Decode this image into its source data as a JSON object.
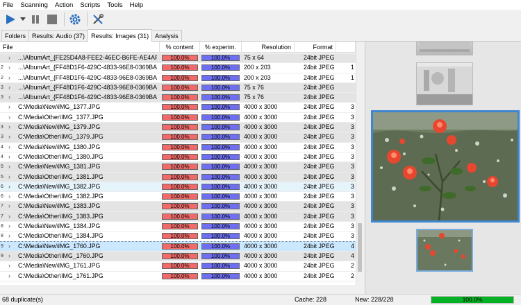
{
  "menu": [
    "File",
    "Scanning",
    "Action",
    "Scripts",
    "Tools",
    "Help"
  ],
  "tabs": [
    "Folders",
    "Results: Audio (37)",
    "Results: Images (31)",
    "Analysis"
  ],
  "columns": {
    "file": "File",
    "content": "% content",
    "experim": "% experim.",
    "resolution": "Resolution",
    "format": "Format"
  },
  "rows": [
    {
      "g": "",
      "path": "...\\AlbumArt_{FE25D4A8-FEE2-46EC-B6FE-AE4AF1",
      "content": "100.0%",
      "experim": "100.0%",
      "res": "75 x 64",
      "fmt": "24bit JPEG",
      "ext": "",
      "style": "grey"
    },
    {
      "g": "2",
      "path": "...\\AlbumArt_{FF48D1F6-429C-4833-96E8-0369BA",
      "content": "100.0%",
      "experim": "100.0%",
      "res": "200 x 203",
      "fmt": "24bit JPEG",
      "ext": "1",
      "style": ""
    },
    {
      "g": "2",
      "path": "...\\AlbumArt_{FF48D1F6-429C-4833-96E8-0369BA",
      "content": "100.0%",
      "experim": "100.0%",
      "res": "200 x 203",
      "fmt": "24bit JPEG",
      "ext": "1",
      "style": ""
    },
    {
      "g": "3",
      "path": "...\\AlbumArt_{FF48D1F6-429C-4833-96E8-0369BA",
      "content": "100.0%",
      "experim": "100.0%",
      "res": "75 x 76",
      "fmt": "24bit JPEG",
      "ext": "",
      "style": "grey"
    },
    {
      "g": "3",
      "path": "...\\AlbumArt_{FF48D1F6-429C-4833-96E8-0369BA",
      "content": "100.0%",
      "experim": "100.0%",
      "res": "75 x 76",
      "fmt": "24bit JPEG",
      "ext": "",
      "style": "grey"
    },
    {
      "g": "",
      "path": "C:\\Media\\New\\IMG_1377.JPG",
      "content": "100.0%",
      "experim": "100.0%",
      "res": "4000 x 3000",
      "fmt": "24bit JPEG",
      "ext": "3",
      "style": ""
    },
    {
      "g": "",
      "path": "C:\\Media\\Other\\IMG_1377.JPG",
      "content": "100.0%",
      "experim": "100.0%",
      "res": "4000 x 3000",
      "fmt": "24bit JPEG",
      "ext": "3",
      "style": ""
    },
    {
      "g": "3",
      "path": "C:\\Media\\New\\IMG_1379.JPG",
      "content": "100.0%",
      "experim": "100.0%",
      "res": "4000 x 3000",
      "fmt": "24bit JPEG",
      "ext": "3",
      "style": "grey"
    },
    {
      "g": "3",
      "path": "C:\\Media\\Other\\IMG_1379.JPG",
      "content": "100.0%",
      "experim": "100.0%",
      "res": "4000 x 3000",
      "fmt": "24bit JPEG",
      "ext": "3",
      "style": "grey"
    },
    {
      "g": "4",
      "path": "C:\\Media\\New\\IMG_1380.JPG",
      "content": "100.0%",
      "experim": "100.0%",
      "res": "4000 x 3000",
      "fmt": "24bit JPEG",
      "ext": "3",
      "style": ""
    },
    {
      "g": "4",
      "path": "C:\\Media\\Other\\IMG_1380.JPG",
      "content": "100.0%",
      "experim": "100.0%",
      "res": "4000 x 3000",
      "fmt": "24bit JPEG",
      "ext": "3",
      "style": ""
    },
    {
      "g": "5",
      "path": "C:\\Media\\New\\IMG_1381.JPG",
      "content": "100.0%",
      "experim": "100.0%",
      "res": "4000 x 3000",
      "fmt": "24bit JPEG",
      "ext": "3",
      "style": "grey"
    },
    {
      "g": "5",
      "path": "C:\\Media\\Other\\IMG_1381.JPG",
      "content": "100.0%",
      "experim": "100.0%",
      "res": "4000 x 3000",
      "fmt": "24bit JPEG",
      "ext": "3",
      "style": "grey"
    },
    {
      "g": "6",
      "path": "C:\\Media\\New\\IMG_1382.JPG",
      "content": "100.0%",
      "experim": "100.0%",
      "res": "4000 x 3000",
      "fmt": "24bit JPEG",
      "ext": "3",
      "style": "blue"
    },
    {
      "g": "6",
      "path": "C:\\Media\\Other\\IMG_1382.JPG",
      "content": "100.0%",
      "experim": "100.0%",
      "res": "4000 x 3000",
      "fmt": "24bit JPEG",
      "ext": "3",
      "style": ""
    },
    {
      "g": "7",
      "path": "C:\\Media\\New\\IMG_1383.JPG",
      "content": "100.0%",
      "experim": "100.0%",
      "res": "4000 x 3000",
      "fmt": "24bit JPEG",
      "ext": "3",
      "style": "grey"
    },
    {
      "g": "7",
      "path": "C:\\Media\\Other\\IMG_1383.JPG",
      "content": "100.0%",
      "experim": "100.0%",
      "res": "4000 x 3000",
      "fmt": "24bit JPEG",
      "ext": "3",
      "style": "grey"
    },
    {
      "g": "8",
      "path": "C:\\Media\\New\\IMG_1384.JPG",
      "content": "100.0%",
      "experim": "100.0%",
      "res": "4000 x 3000",
      "fmt": "24bit JPEG",
      "ext": "3",
      "style": ""
    },
    {
      "g": "8",
      "path": "C:\\Media\\Other\\IMG_1384.JPG",
      "content": "100.0%",
      "experim": "100.0%",
      "res": "4000 x 3000",
      "fmt": "24bit JPEG",
      "ext": "3",
      "style": ""
    },
    {
      "g": "9",
      "path": "C:\\Media\\New\\IMG_1760.JPG",
      "content": "100.0%",
      "experim": "100.0%",
      "res": "4000 x 3000",
      "fmt": "24bit JPEG",
      "ext": "4",
      "style": "sel"
    },
    {
      "g": "9",
      "path": "C:\\Media\\Other\\IMG_1760.JPG",
      "content": "100.0%",
      "experim": "100.0%",
      "res": "4000 x 3000",
      "fmt": "24bit JPEG",
      "ext": "4",
      "style": "grey"
    },
    {
      "g": "",
      "path": "C:\\Media\\New\\IMG_1761.JPG",
      "content": "100.0%",
      "experim": "100.0%",
      "res": "4000 x 3000",
      "fmt": "24bit JPEG",
      "ext": "2",
      "style": ""
    },
    {
      "g": "",
      "path": "C:\\Media\\Other\\IMG_1761.JPG",
      "content": "100.0%",
      "experim": "100.0%",
      "res": "4000 x 3000",
      "fmt": "24bit JPEG",
      "ext": "2",
      "style": ""
    }
  ],
  "status": {
    "duplicates": "68 duplicate(s)",
    "cache": "Cache: 228",
    "new": "New: 228/228",
    "progress_label": "100.0%",
    "progress_value": 1.0
  },
  "colors": {
    "content_bar": "#f06a6a",
    "experim_bar": "#6e6ef0",
    "selection": "#3f86d0",
    "progress": "#06b025"
  }
}
